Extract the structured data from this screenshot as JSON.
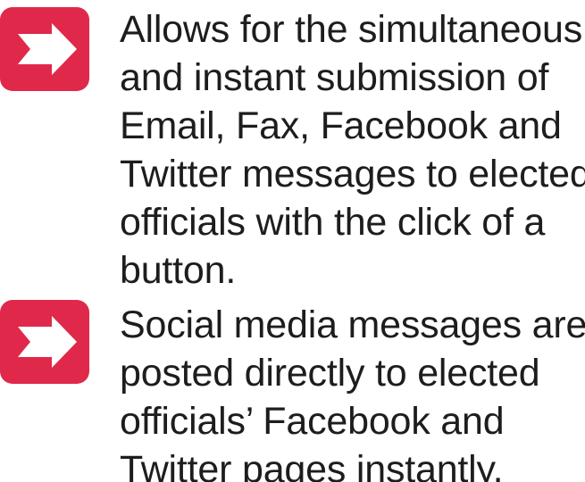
{
  "bullets": [
    {
      "icon": "arrow-right-icon",
      "lines": [
        "Allows for the simultaneous",
        "and instant submission of",
        "Email, Fax, Facebook and",
        "Twitter messages to elected",
        "officials with the click of a",
        "button."
      ]
    },
    {
      "icon": "arrow-right-icon",
      "lines": [
        "Social media messages are",
        "posted directly to elected",
        "officials’ Facebook and",
        "Twitter pages instantly."
      ]
    }
  ],
  "colors": {
    "badge": "#e0294a",
    "arrow": "#ffffff",
    "text": "#1d1d1f"
  }
}
